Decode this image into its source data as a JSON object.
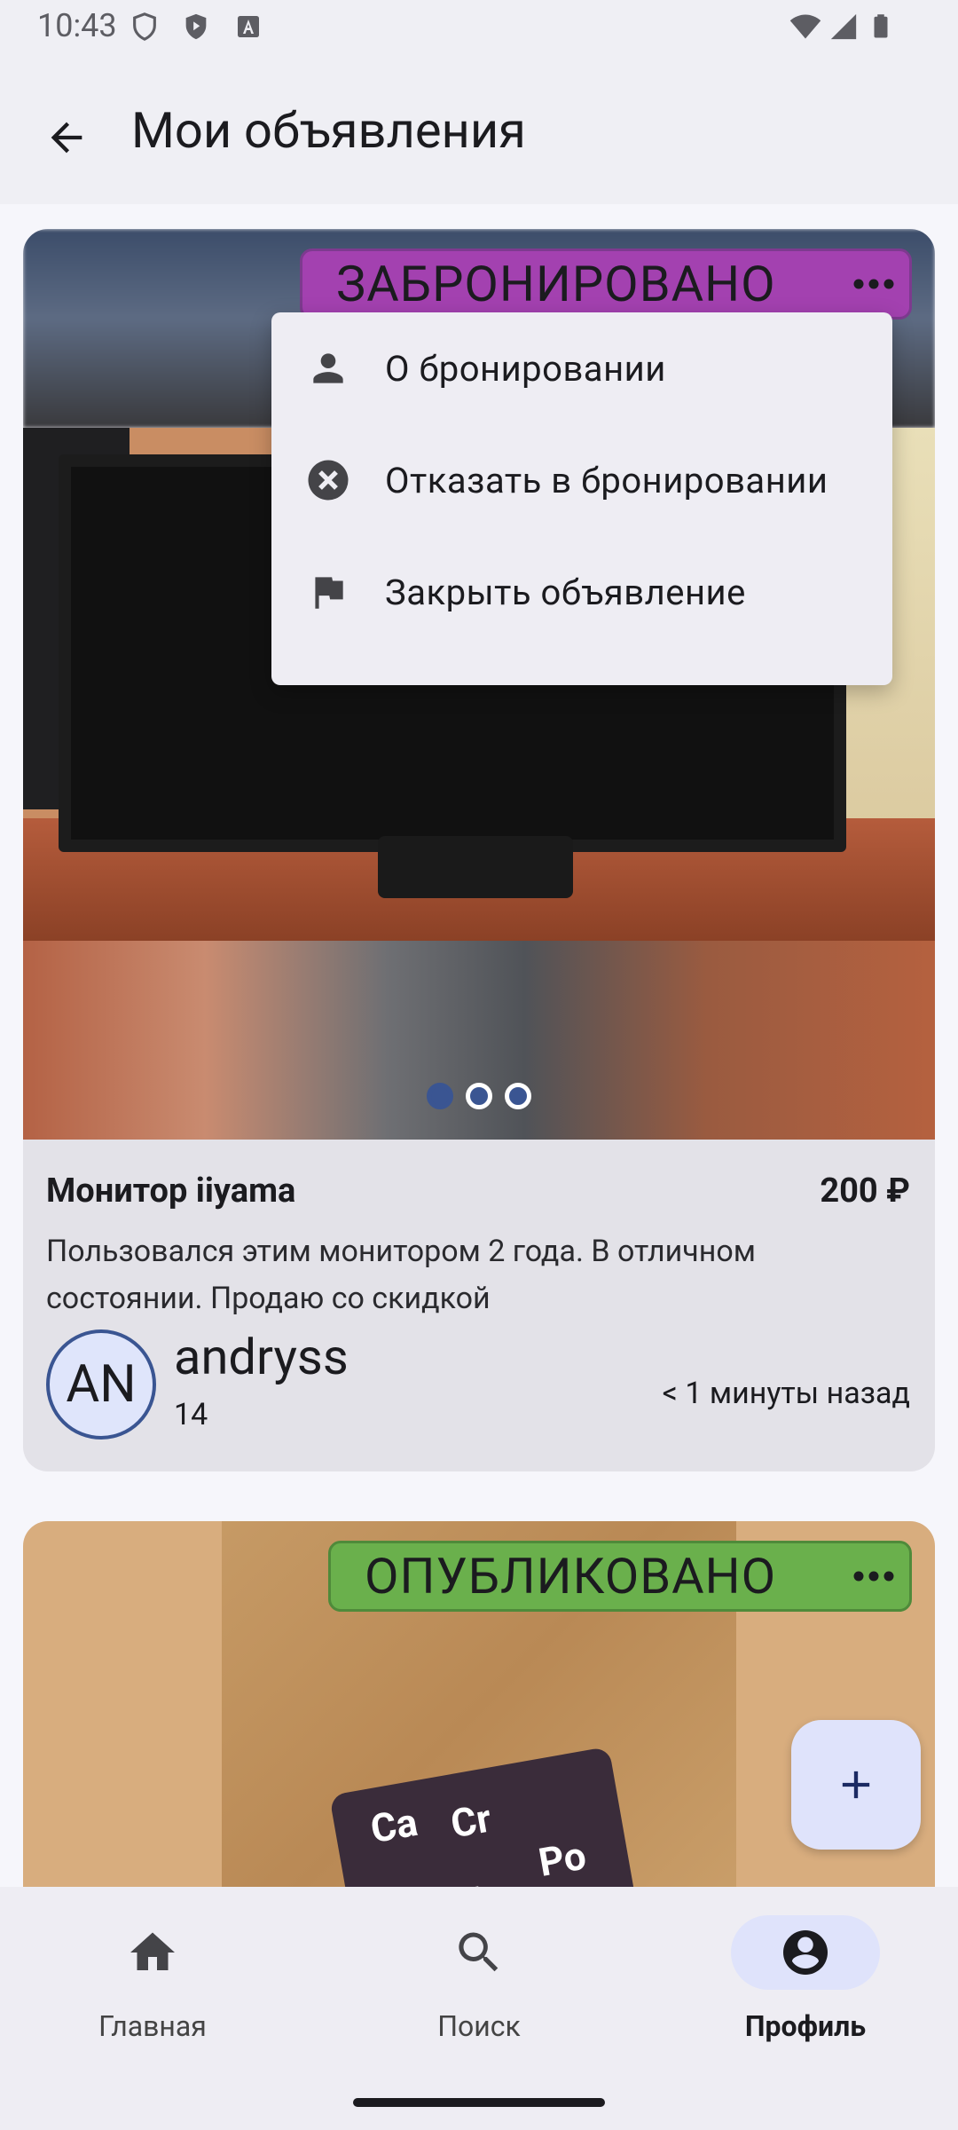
{
  "status_bar": {
    "time": "10:43"
  },
  "app_bar": {
    "title": "Мои объявления"
  },
  "listing1": {
    "status": "ЗАБРОНИРОВАНО",
    "status_color": "#a341b0",
    "title": "Монитор iiyama",
    "price": "200 ₽",
    "description": "Пользовался этим монитором 2 года. В отличном состоянии. Продаю со скидкой",
    "avatar_initials": "AN",
    "user_name": "andryss",
    "user_rating": "14",
    "posted": "< 1 минуты назад",
    "photo_count": 3,
    "current_photo": 1
  },
  "menu": {
    "items": [
      {
        "label": "О бронировании",
        "icon": "person-icon"
      },
      {
        "label": "Отказать в бронировании",
        "icon": "cancel-icon"
      },
      {
        "label": "Закрыть объявление",
        "icon": "flag-icon"
      }
    ]
  },
  "listing2": {
    "status": "ОПУБЛИКОВАНО",
    "status_color": "#6ab04c"
  },
  "bottom_nav": {
    "items": [
      {
        "label": "Главная",
        "icon": "home-icon"
      },
      {
        "label": "Поиск",
        "icon": "search-icon"
      },
      {
        "label": "Профиль",
        "icon": "account-circle-icon",
        "active": true
      }
    ]
  }
}
